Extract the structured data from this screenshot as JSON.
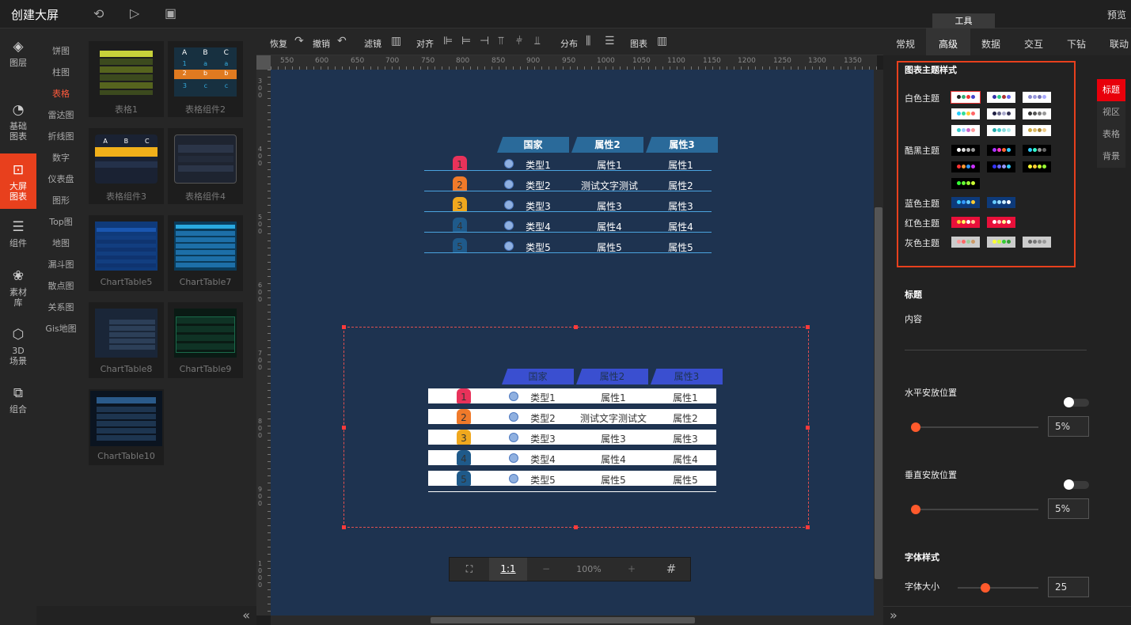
{
  "topbar": {
    "title": "创建大屏",
    "preview": "预览",
    "tools_tab": "工具"
  },
  "leftnav": [
    {
      "label1": "图层",
      "label2": "",
      "icon": "layers-icon"
    },
    {
      "label1": "基础",
      "label2": "图表",
      "icon": "pie-icon"
    },
    {
      "label1": "大屏",
      "label2": "图表",
      "icon": "bigscreen-icon"
    },
    {
      "label1": "组件",
      "label2": "",
      "icon": "sliders-icon"
    },
    {
      "label1": "素材",
      "label2": "库",
      "icon": "material-icon"
    },
    {
      "label1": "3D",
      "label2": "场景",
      "icon": "cube-icon"
    },
    {
      "label1": "组合",
      "label2": "",
      "icon": "group-icon"
    }
  ],
  "categories": [
    "饼图",
    "柱图",
    "表格",
    "雷达图",
    "折线图",
    "数字",
    "仪表盘",
    "图形",
    "Top图",
    "地图",
    "漏斗图",
    "散点图",
    "关系图",
    "Gis地图"
  ],
  "thumbs": [
    "表格1",
    "表格组件2",
    "表格组件3",
    "表格组件4",
    "ChartTable5",
    "ChartTable7",
    "ChartTable8",
    "ChartTable9",
    "ChartTable10"
  ],
  "thumb_preview": {
    "a": "A",
    "b": "B",
    "c": "C",
    "r1": "1",
    "r2": "2",
    "r3": "3",
    "la": "a",
    "lb": "b",
    "lc": "c"
  },
  "toolbar": {
    "redo": "恢复",
    "undo": "撤销",
    "filter": "滤镜",
    "align": "对齐",
    "distribute": "分布",
    "chart": "图表"
  },
  "ruler_ticks": [
    "550",
    "600",
    "650",
    "700",
    "750",
    "800",
    "850",
    "900",
    "950",
    "1000",
    "1050",
    "1100",
    "1150",
    "1200",
    "1250",
    "1300",
    "1350"
  ],
  "ruler_v_ticks": [
    "300",
    "400",
    "500",
    "600",
    "700",
    "800",
    "900",
    "1000"
  ],
  "zoom": {
    "fit": "⛶",
    "one": "1:1",
    "minus": "−",
    "level": "100%",
    "plus": "+",
    "grid": "#"
  },
  "table1": {
    "headers": [
      "国家",
      "属性2",
      "属性3"
    ],
    "rows": [
      {
        "n": "1",
        "a": "类型1",
        "b": "属性1",
        "c": "属性1"
      },
      {
        "n": "2",
        "a": "类型2",
        "b": "测试文字测试",
        "c": "属性2"
      },
      {
        "n": "3",
        "a": "类型3",
        "b": "属性3",
        "c": "属性3"
      },
      {
        "n": "4",
        "a": "类型4",
        "b": "属性4",
        "c": "属性4"
      },
      {
        "n": "5",
        "a": "类型5",
        "b": "属性5",
        "c": "属性5"
      }
    ]
  },
  "table2": {
    "headers": [
      "国家",
      "属性2",
      "属性3"
    ],
    "rows": [
      {
        "n": "1",
        "a": "类型1",
        "b": "属性1",
        "c": "属性1"
      },
      {
        "n": "2",
        "a": "类型2",
        "b": "测试文字测试文",
        "c": "属性2"
      },
      {
        "n": "3",
        "a": "类型3",
        "b": "属性3",
        "c": "属性3"
      },
      {
        "n": "4",
        "a": "类型4",
        "b": "属性4",
        "c": "属性4"
      },
      {
        "n": "5",
        "a": "类型5",
        "b": "属性5",
        "c": "属性5"
      }
    ]
  },
  "badge_colors": [
    "#e8325a",
    "#f07a2a",
    "#f0a81e",
    "#1f5a8a",
    "#1f5a8a"
  ],
  "right": {
    "tabs": [
      "常规",
      "高级",
      "数据",
      "交互",
      "下钻",
      "联动"
    ],
    "theme_title": "图表主题样式",
    "themes": [
      "白色主题",
      "酷黑主题",
      "蓝色主题",
      "红色主题",
      "灰色主题"
    ],
    "side_tabs": [
      "标题",
      "视区",
      "表格",
      "背景"
    ],
    "title_section": "标题",
    "content_label": "内容",
    "h_pos": "水平安放位置",
    "h_val": "5%",
    "v_pos": "垂直安放位置",
    "v_val": "5%",
    "font_style": "字体样式",
    "font_size": "字体大小",
    "font_val": "25"
  }
}
